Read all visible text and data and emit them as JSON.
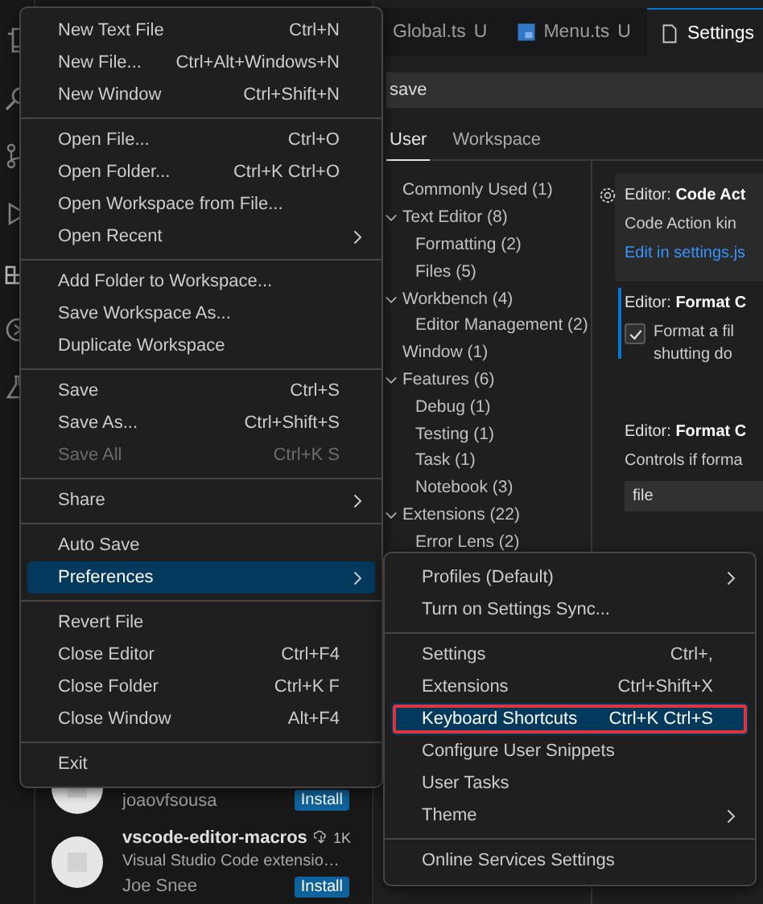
{
  "activity_bar": {
    "items": [
      {
        "kind": "files"
      },
      {
        "kind": "search"
      },
      {
        "kind": "branch"
      },
      {
        "kind": "run"
      },
      {
        "kind": "extensions"
      },
      {
        "kind": "remote"
      },
      {
        "kind": "testing"
      }
    ]
  },
  "tabs": [
    {
      "label": "Global.ts",
      "status": "U",
      "kind": "none",
      "selected": false
    },
    {
      "label": "Menu.ts",
      "status": "U",
      "kind": "typescript",
      "selected": false
    },
    {
      "label": "Settings",
      "kind": "file",
      "selected": true
    }
  ],
  "settings": {
    "search": {
      "value": "save"
    },
    "scopes": [
      {
        "label": "User",
        "selected": true
      },
      {
        "label": "Workspace",
        "selected": false
      }
    ],
    "toc": [
      {
        "label": "Commonly Used (1)"
      },
      {
        "label": "Text Editor (8)",
        "expanded": true,
        "children": [
          {
            "label": "Formatting (2)"
          },
          {
            "label": "Files (5)"
          }
        ]
      },
      {
        "label": "Workbench (4)",
        "expanded": true,
        "children": [
          {
            "label": "Editor Management (2)"
          }
        ]
      },
      {
        "label": "Window (1)"
      },
      {
        "label": "Features (6)",
        "expanded": true,
        "children": [
          {
            "label": "Debug (1)"
          },
          {
            "label": "Testing (1)"
          },
          {
            "label": "Task (1)"
          },
          {
            "label": "Notebook (3)"
          }
        ]
      },
      {
        "label": "Extensions (22)",
        "expanded": true,
        "children": [
          {
            "label": "Error Lens (2)"
          }
        ]
      }
    ],
    "entries": [
      {
        "kind": "link",
        "hovered": true,
        "modified": false,
        "title": "Editor: **Code Act**",
        "description": "Code Action kin",
        "link": "Edit in settings.js"
      },
      {
        "kind": "checkbox",
        "hovered": false,
        "modified": true,
        "title": "Editor: **Format C**",
        "checked": true,
        "description": "Format a fil",
        "description_2": "shutting do"
      },
      {
        "kind": "dropdown",
        "hovered": false,
        "modified": false,
        "title": "Editor: **Format C**",
        "description": "Controls if forma",
        "value": "file"
      }
    ]
  },
  "extensions": [
    {
      "publisher": "joaovfsousa",
      "action": "Install"
    },
    {
      "name": "vscode-editor-macros",
      "downloads": "1K",
      "description": "Visual Studio Code extensio…",
      "publisher": "Joe Snee",
      "action": "Install"
    }
  ],
  "file_menu": {
    "groups": [
      [
        {
          "label": "New Text File",
          "shortcut": "Ctrl+N",
          "submenu": false,
          "disabled": false,
          "selected": false
        },
        {
          "label": "New File...",
          "shortcut": "Ctrl+Alt+Windows+N",
          "submenu": false,
          "disabled": false,
          "selected": false
        },
        {
          "label": "New Window",
          "shortcut": "Ctrl+Shift+N",
          "submenu": false,
          "disabled": false,
          "selected": false
        }
      ],
      [
        {
          "label": "Open File...",
          "shortcut": "Ctrl+O",
          "submenu": false,
          "disabled": false,
          "selected": false
        },
        {
          "label": "Open Folder...",
          "shortcut": "Ctrl+K Ctrl+O",
          "submenu": false,
          "disabled": false,
          "selected": false
        },
        {
          "label": "Open Workspace from File...",
          "submenu": false,
          "disabled": false,
          "selected": false
        },
        {
          "label": "Open Recent",
          "submenu": true,
          "disabled": false,
          "selected": false
        }
      ],
      [
        {
          "label": "Add Folder to Workspace...",
          "submenu": false,
          "disabled": false,
          "selected": false
        },
        {
          "label": "Save Workspace As...",
          "submenu": false,
          "disabled": false,
          "selected": false
        },
        {
          "label": "Duplicate Workspace",
          "submenu": false,
          "disabled": false,
          "selected": false
        }
      ],
      [
        {
          "label": "Save",
          "shortcut": "Ctrl+S",
          "submenu": false,
          "disabled": false,
          "selected": false
        },
        {
          "label": "Save As...",
          "shortcut": "Ctrl+Shift+S",
          "submenu": false,
          "disabled": false,
          "selected": false
        },
        {
          "label": "Save All",
          "shortcut": "Ctrl+K S",
          "submenu": false,
          "disabled": true,
          "selected": false
        }
      ],
      [
        {
          "label": "Share",
          "submenu": true,
          "disabled": false,
          "selected": false
        }
      ],
      [
        {
          "label": "Auto Save",
          "submenu": false,
          "disabled": false,
          "selected": false
        },
        {
          "label": "Preferences",
          "submenu": true,
          "disabled": false,
          "selected": true
        }
      ],
      [
        {
          "label": "Revert File",
          "submenu": false,
          "disabled": false,
          "selected": false
        },
        {
          "label": "Close Editor",
          "shortcut": "Ctrl+F4",
          "submenu": false,
          "disabled": false,
          "selected": false
        },
        {
          "label": "Close Folder",
          "shortcut": "Ctrl+K F",
          "submenu": false,
          "disabled": false,
          "selected": false
        },
        {
          "label": "Close Window",
          "shortcut": "Alt+F4",
          "submenu": false,
          "disabled": false,
          "selected": false
        }
      ],
      [
        {
          "label": "Exit",
          "submenu": false,
          "disabled": false,
          "selected": false
        }
      ]
    ]
  },
  "preferences_menu": {
    "groups": [
      [
        {
          "label": "Profiles (Default)",
          "submenu": true,
          "selected": false,
          "outlined": false
        },
        {
          "label": "Turn on Settings Sync...",
          "submenu": false,
          "selected": false,
          "outlined": false
        }
      ],
      [
        {
          "label": "Settings",
          "shortcut": "Ctrl+,",
          "submenu": false,
          "selected": false,
          "outlined": false
        },
        {
          "label": "Extensions",
          "shortcut": "Ctrl+Shift+X",
          "submenu": false,
          "selected": false,
          "outlined": false
        },
        {
          "label": "Keyboard Shortcuts",
          "shortcut": "Ctrl+K Ctrl+S",
          "submenu": false,
          "selected": true,
          "outlined": true
        },
        {
          "label": "Configure User Snippets",
          "submenu": false,
          "selected": false,
          "outlined": false
        },
        {
          "label": "User Tasks",
          "submenu": false,
          "selected": false,
          "outlined": false
        },
        {
          "label": "Theme",
          "submenu": true,
          "selected": false,
          "outlined": false
        }
      ],
      [
        {
          "label": "Online Services Settings",
          "submenu": false,
          "selected": false,
          "outlined": false
        }
      ]
    ]
  }
}
